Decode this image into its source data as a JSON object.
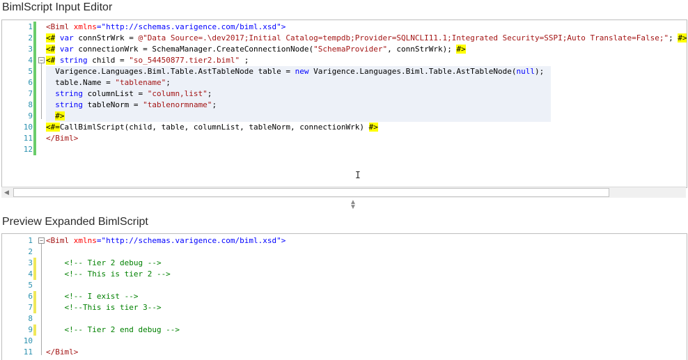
{
  "input_editor": {
    "title": "BimlScript Input Editor",
    "lines": [
      {
        "n": "1",
        "parts": [
          {
            "t": "<Biml ",
            "c": "tag"
          },
          {
            "t": "xmlns",
            "c": "attr"
          },
          {
            "t": "=\"http://schemas.varigence.com/biml.xsd\">",
            "c": "xml"
          }
        ]
      },
      {
        "n": "2",
        "parts": [
          {
            "t": "<#",
            "c": "hl"
          },
          {
            "t": " var ",
            "c": "kw"
          },
          {
            "t": "connStrWrk = ",
            "c": ""
          },
          {
            "t": "@\"Data Source=.\\dev2017;Initial Catalog=tempdb;Provider=SQLNCLI11.1;Integrated Security=SSPI;Auto Translate=False;\"",
            "c": "str"
          },
          {
            "t": "; ",
            "c": ""
          },
          {
            "t": "#>",
            "c": "hl"
          }
        ]
      },
      {
        "n": "3",
        "parts": [
          {
            "t": "<#",
            "c": "hl"
          },
          {
            "t": " var ",
            "c": "kw"
          },
          {
            "t": "connectionWrk = SchemaManager.CreateConnectionNode(",
            "c": ""
          },
          {
            "t": "\"SchemaProvider\"",
            "c": "str"
          },
          {
            "t": ", connStrWrk); ",
            "c": ""
          },
          {
            "t": "#>",
            "c": "hl"
          }
        ]
      },
      {
        "n": "4",
        "parts": [
          {
            "t": "<#",
            "c": "hl"
          },
          {
            "t": " string ",
            "c": "kw"
          },
          {
            "t": "child = ",
            "c": ""
          },
          {
            "t": "\"so_54450877.tier2.biml\"",
            "c": "str"
          },
          {
            "t": " ;",
            "c": ""
          }
        ]
      },
      {
        "n": "5",
        "parts": [
          {
            "t": "  Varigence.Languages.Biml.Table.AstTableNode table = ",
            "c": ""
          },
          {
            "t": "new ",
            "c": "kw"
          },
          {
            "t": "Varigence.Languages.Biml.Table.AstTableNode(",
            "c": ""
          },
          {
            "t": "null",
            "c": "kw"
          },
          {
            "t": ");",
            "c": ""
          }
        ]
      },
      {
        "n": "6",
        "parts": [
          {
            "t": "  table.Name = ",
            "c": ""
          },
          {
            "t": "\"tablename\"",
            "c": "str"
          },
          {
            "t": ";",
            "c": ""
          }
        ]
      },
      {
        "n": "7",
        "parts": [
          {
            "t": "  string ",
            "c": "kw"
          },
          {
            "t": "columnList = ",
            "c": ""
          },
          {
            "t": "\"column,list\"",
            "c": "str"
          },
          {
            "t": ";",
            "c": ""
          }
        ]
      },
      {
        "n": "8",
        "parts": [
          {
            "t": "  string ",
            "c": "kw"
          },
          {
            "t": "tableNorm = ",
            "c": ""
          },
          {
            "t": "\"tablenormname\"",
            "c": "str"
          },
          {
            "t": ";",
            "c": ""
          }
        ]
      },
      {
        "n": "9",
        "parts": [
          {
            "t": "  ",
            "c": ""
          },
          {
            "t": "#>",
            "c": "hl"
          }
        ]
      },
      {
        "n": "10",
        "parts": [
          {
            "t": "<#=",
            "c": "hl"
          },
          {
            "t": "CallBimlScript(child, table, columnList, tableNorm, connectionWrk) ",
            "c": ""
          },
          {
            "t": "#>",
            "c": "hl"
          }
        ]
      },
      {
        "n": "11",
        "parts": [
          {
            "t": "</Biml>",
            "c": "tag"
          }
        ]
      },
      {
        "n": "12",
        "parts": []
      }
    ]
  },
  "preview_editor": {
    "title": "Preview Expanded BimlScript",
    "lines": [
      {
        "n": "1",
        "parts": [
          {
            "t": "<Biml ",
            "c": "tag"
          },
          {
            "t": "xmlns",
            "c": "attr"
          },
          {
            "t": "=\"http://schemas.varigence.com/biml.xsd\">",
            "c": "xml"
          }
        ]
      },
      {
        "n": "2",
        "parts": []
      },
      {
        "n": "3",
        "parts": [
          {
            "t": "    <!-- Tier 2 debug -->",
            "c": "com"
          }
        ]
      },
      {
        "n": "4",
        "parts": [
          {
            "t": "    <!-- This is tier 2 -->",
            "c": "com"
          }
        ]
      },
      {
        "n": "5",
        "parts": []
      },
      {
        "n": "6",
        "parts": [
          {
            "t": "    <!-- I exist -->",
            "c": "com"
          }
        ]
      },
      {
        "n": "7",
        "parts": [
          {
            "t": "    <!--This is tier 3-->",
            "c": "com"
          }
        ]
      },
      {
        "n": "8",
        "parts": []
      },
      {
        "n": "9",
        "parts": [
          {
            "t": "    <!-- Tier 2 end debug -->",
            "c": "com"
          }
        ]
      },
      {
        "n": "10",
        "parts": []
      },
      {
        "n": "11",
        "parts": [
          {
            "t": "</Biml>",
            "c": "tag"
          }
        ]
      }
    ]
  },
  "colors": {
    "change_bar_saved": "#6acd6a",
    "change_bar_modified": "#f0e85a",
    "highlight": "#ffff00"
  }
}
